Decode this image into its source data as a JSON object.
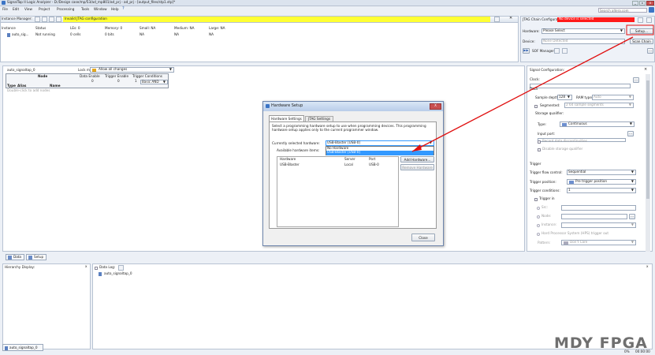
{
  "app": {
    "title": "SignalTap II Logic Analyzer - D:/Design case/mp/53/ad_mp801/ad_prj - ad_prj - [output_files/stp1.stp]*"
  },
  "menubar": {
    "items": [
      "File",
      "Edit",
      "View",
      "Project",
      "Processing",
      "Tools",
      "Window",
      "Help"
    ],
    "search_placeholder": "Search altera.com"
  },
  "instance_manager": {
    "label": "Instance Manager:",
    "status_text": "Invalid JTAG configuration",
    "columns": [
      "Instance",
      "Status",
      "LEs: 0",
      "Memory: 0",
      "Small: NA",
      "Medium: NA",
      "Large: NA"
    ],
    "row": [
      "auto_sig...",
      "Not running",
      "0 cells",
      "0 bits",
      "NA",
      "NA",
      "NA"
    ]
  },
  "jtag": {
    "label": "JTAG Chain Configuration:",
    "status": "No device is selected",
    "hardware_label": "Hardware:",
    "hardware_value": "Please Select",
    "setup_button": "Setup...",
    "device_label": "Device:",
    "device_value": "None Detected",
    "scan_button": "Scan Chain",
    "sof_label": "SOF Manager:",
    "sof_browse": "..."
  },
  "node_panel": {
    "instance": "auto_signaltap_0",
    "lock_label": "Lock mode:",
    "lock_value": "Allow all changes",
    "node_header": "Node",
    "cols": [
      "Data Enable",
      "Trigger Enable",
      "Trigger Conditions"
    ],
    "counts": [
      "0",
      "0",
      "1"
    ],
    "type_cols": [
      "Type",
      "Alias",
      "Name"
    ],
    "basic": "Basic AND",
    "hint": "Double-click to add nodes"
  },
  "dialog": {
    "title": "Hardware Setup",
    "close_x": "X",
    "tabs": [
      "Hardware Settings",
      "JTAG Settings"
    ],
    "description": "Select a programming hardware setup to use when programming devices. This programming hardware setup applies only to the current programmer window.",
    "current_label": "Currently selected hardware:",
    "current_value": "USB-Blaster [USB-0]",
    "available_label": "Available hardware items:",
    "dropdown_items": [
      "No Hardware",
      "USB-Blaster [USB-0]"
    ],
    "columns": [
      "Hardware",
      "Server",
      "Port"
    ],
    "row": [
      "USB-Blaster",
      "Local",
      "USB-0"
    ],
    "add_button": "Add Hardware...",
    "remove_button": "Remove Hardware",
    "close_button": "Close"
  },
  "signal_config": {
    "title": "Signal Configuration:",
    "clock_label": "Clock:",
    "clock_browse": "...",
    "data_header": "Data",
    "sample_depth_label": "Sample depth:",
    "sample_depth_value": "128",
    "ram_type_label": "RAM type:",
    "ram_type_value": "Auto",
    "segmented_label": "Segmented:",
    "segmented_value": "2  64 sample segments",
    "storage_header": "Storage qualifier:",
    "type_label": "Type:",
    "type_value": "Continuous",
    "input_port_label": "Input port:",
    "input_browse": "...",
    "record_label": "Record data discontinuities",
    "disable_label": "Disable storage qualifier",
    "trigger_header": "Trigger",
    "flow_label": "Trigger flow control:",
    "flow_value": "Sequential",
    "position_label": "Trigger position:",
    "position_value": "Pre trigger position",
    "conditions_label": "Trigger conditions:",
    "conditions_value": "1",
    "trigger_in_label": "Trigger in",
    "src_label": "Src:",
    "node_label": "Node:",
    "instance_label": "Instance:",
    "hps_label": "Hard Processor System (HPS) trigger out",
    "pattern_label": "Pattern:",
    "pattern_value": "Don't Care"
  },
  "tabs": {
    "data": "Data",
    "setup": "Setup"
  },
  "hierarchy": {
    "title": "Hierarchy Display:",
    "close": "x"
  },
  "datalog": {
    "title": "Data Log:",
    "item": "auto_signaltap_0",
    "close": "x"
  },
  "bottom": {
    "instance_tab": "auto_signaltap_0",
    "status_pct": "0%",
    "status_time": "00:00:00"
  },
  "watermark": "MDY FPGA",
  "colors": {
    "invalid_bg": "#ffff33",
    "error_bg": "#ff1a1a",
    "selected": "#3399ff"
  }
}
